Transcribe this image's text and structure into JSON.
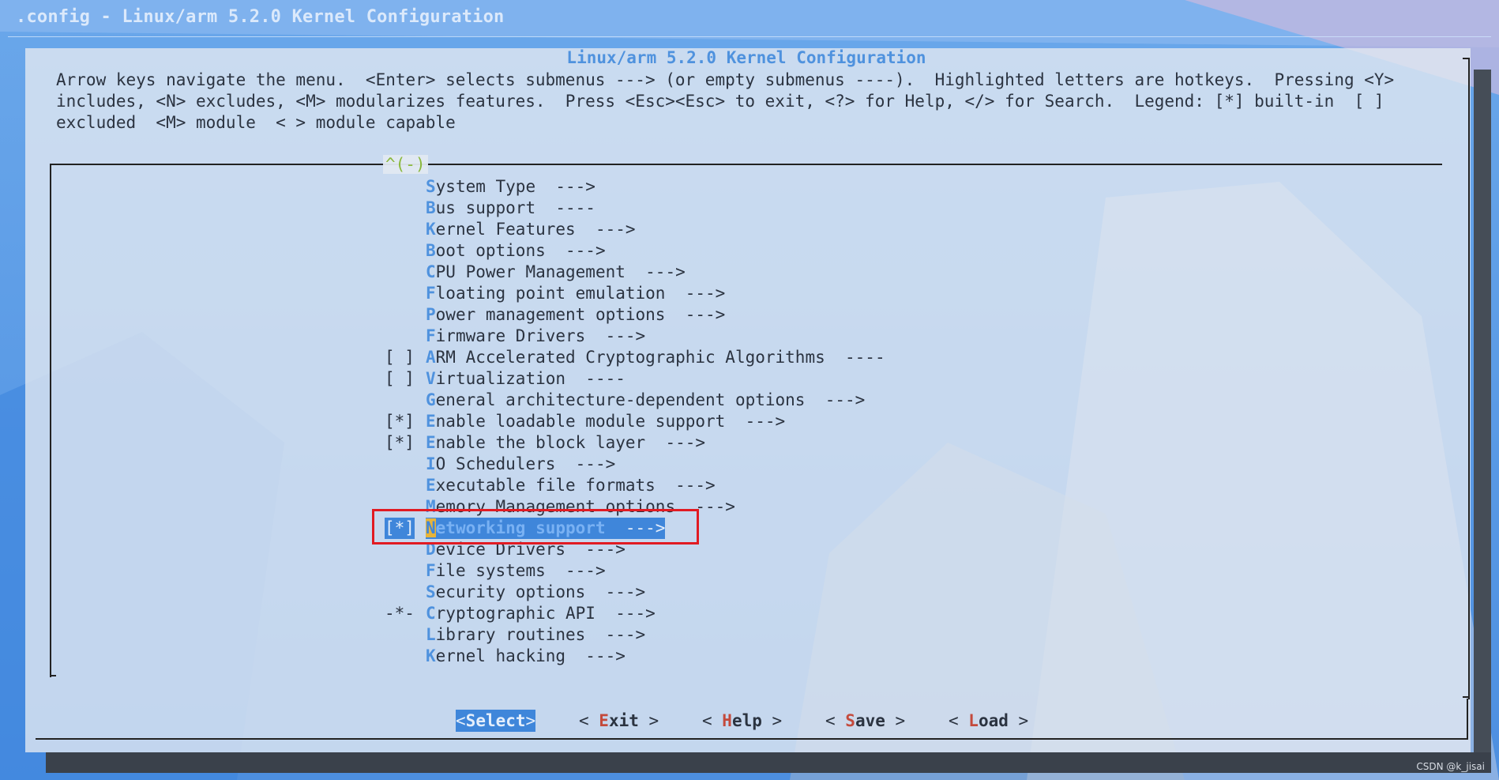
{
  "window": {
    "title": ".config - Linux/arm 5.2.0 Kernel Configuration"
  },
  "dialog": {
    "heading": "Linux/arm 5.2.0 Kernel Configuration",
    "help_text": "Arrow keys navigate the menu.  <Enter> selects submenus ---> (or empty submenus ----).  Highlighted letters are hotkeys.  Pressing <Y>\nincludes, <N> excludes, <M> modularizes features.  Press <Esc><Esc> to exit, <?> for Help, </> for Search.  Legend: [*] built-in  [ ]\nexcluded  <M> module  < > module capable",
    "scroll_indicator": "^(-)"
  },
  "menu": [
    {
      "flag": "",
      "hotkey": "S",
      "rest": "ystem Type  --->"
    },
    {
      "flag": "",
      "hotkey": "B",
      "rest": "us support  ----"
    },
    {
      "flag": "",
      "hotkey": "K",
      "rest": "ernel Features  --->"
    },
    {
      "flag": "",
      "hotkey": "B",
      "rest": "oot options  --->"
    },
    {
      "flag": "",
      "hotkey": "C",
      "rest": "PU Power Management  --->"
    },
    {
      "flag": "",
      "hotkey": "F",
      "rest": "loating point emulation  --->"
    },
    {
      "flag": "",
      "hotkey": "P",
      "rest": "ower management options  --->"
    },
    {
      "flag": "",
      "hotkey": "F",
      "rest": "irmware Drivers  --->"
    },
    {
      "flag": "[ ]",
      "hotkey": "A",
      "rest": "RM Accelerated Cryptographic Algorithms  ----"
    },
    {
      "flag": "[ ]",
      "hotkey": "V",
      "rest": "irtualization  ----"
    },
    {
      "flag": "",
      "hotkey": "G",
      "rest": "eneral architecture-dependent options  --->"
    },
    {
      "flag": "[*]",
      "hotkey": "E",
      "rest": "nable loadable module support  --->"
    },
    {
      "flag": "[*]",
      "hotkey": "E",
      "rest": "nable the block layer  --->"
    },
    {
      "flag": "",
      "hotkey": "I",
      "rest": "O Schedulers  --->"
    },
    {
      "flag": "",
      "hotkey": "E",
      "rest": "xecutable file formats  --->"
    },
    {
      "flag": "",
      "hotkey": "M",
      "rest": "emory Management options  --->"
    },
    {
      "flag": "[*]",
      "hotkey": "N",
      "rest": "etworking support",
      "arrow": "  --->",
      "selected": true
    },
    {
      "flag": "",
      "hotkey": "D",
      "rest": "evice Drivers  --->"
    },
    {
      "flag": "",
      "hotkey": "F",
      "rest": "ile systems  --->"
    },
    {
      "flag": "",
      "hotkey": "S",
      "rest": "ecurity options  --->"
    },
    {
      "flag": "-*-",
      "hotkey": "C",
      "rest": "ryptographic API  --->"
    },
    {
      "flag": "",
      "hotkey": "L",
      "rest": "ibrary routines  --->"
    },
    {
      "flag": "",
      "hotkey": "K",
      "rest": "ernel hacking  --->"
    }
  ],
  "buttons": [
    {
      "left": "<",
      "hotkey": "S",
      "name": "elect",
      "right": ">",
      "active": true
    },
    {
      "left": "< ",
      "hotkey": "E",
      "name": "xit",
      "right": " >"
    },
    {
      "left": "< ",
      "hotkey": "H",
      "name": "elp",
      "right": " >"
    },
    {
      "left": "< ",
      "hotkey": "S",
      "name": "ave",
      "right": " >"
    },
    {
      "left": "< ",
      "hotkey": "L",
      "name": "oad",
      "right": " >"
    }
  ],
  "watermark": "CSDN @k_jisai",
  "colors": {
    "accent": "#3f86da",
    "hotkey": "#4f92de",
    "button_hotkey": "#c44a3c",
    "highlight_box": "#e11b23"
  }
}
